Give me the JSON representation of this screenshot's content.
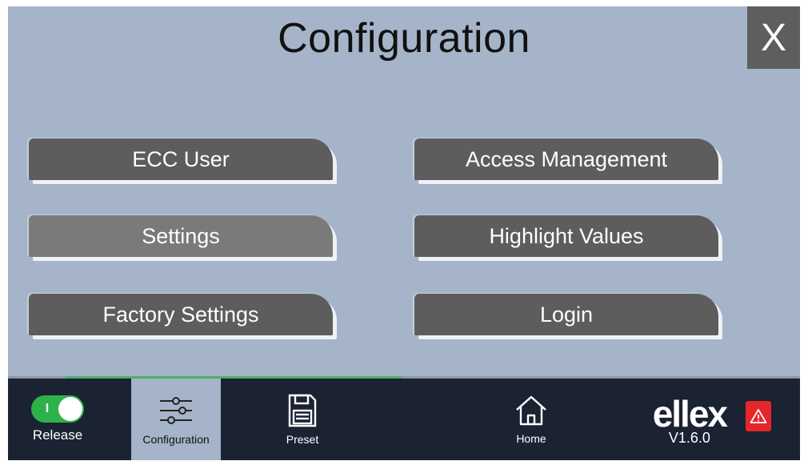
{
  "header": {
    "title": "Configuration",
    "close_label": "X"
  },
  "menu": {
    "ecc_user": "ECC User",
    "access_management": "Access Management",
    "settings": "Settings",
    "highlight_values": "Highlight Values",
    "factory_settings": "Factory Settings",
    "login": "Login"
  },
  "bottom_nav": {
    "release": {
      "label": "Release",
      "icon": "toggle-icon",
      "toggle_mark": "I"
    },
    "configuration": {
      "label": "Configuration",
      "icon": "sliders-icon"
    },
    "preset": {
      "label": "Preset",
      "icon": "floppy-disk-icon"
    },
    "home": {
      "label": "Home",
      "icon": "home-icon"
    }
  },
  "brand": {
    "logo": "ellex",
    "version": "V1.6.0"
  },
  "alarm": {
    "icon": "warning-icon"
  },
  "colors": {
    "background": "#a5b4c8",
    "button": "#5d5d5d",
    "button_active": "#7a7a7a",
    "bottom_bar": "#1b2232",
    "toggle_on": "#2db24a",
    "alarm": "#e5262b"
  }
}
